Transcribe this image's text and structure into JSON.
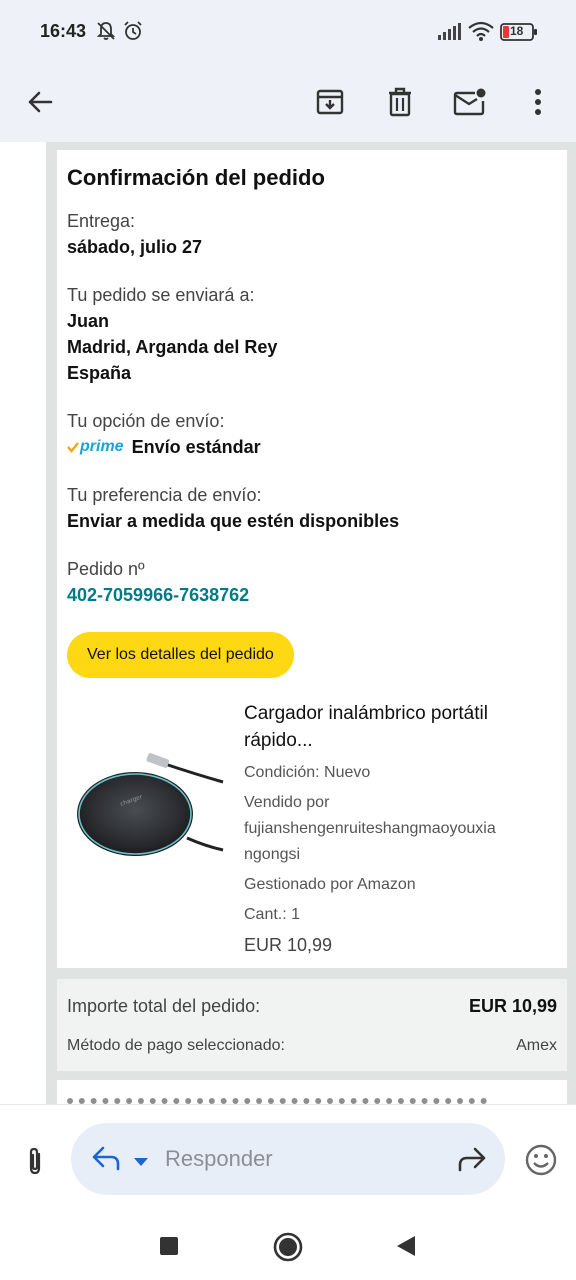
{
  "status_bar": {
    "time": "16:43",
    "icons": [
      "notifications-off-icon",
      "alarm-icon",
      "signal-icon",
      "wifi-icon",
      "battery-icon"
    ],
    "battery_level": "18"
  },
  "toolbar": {
    "icons": [
      "back-arrow-icon",
      "archive-icon",
      "delete-icon",
      "mark-unread-icon",
      "more-vert-icon"
    ]
  },
  "email": {
    "heading": "Confirmación del pedido",
    "delivery_label": "Entrega:",
    "delivery_value": "sábado, julio 27",
    "ship_to_label": "Tu pedido se enviará a:",
    "ship_to_name": "Juan",
    "ship_to_city": "Madrid, Arganda del Rey",
    "ship_to_country": "España",
    "shipping_option_label": "Tu opción de envío:",
    "prime_logo_text": "prime",
    "shipping_option_value": "Envío estándar",
    "shipping_pref_label": "Tu preferencia de envío:",
    "shipping_pref_value": "Enviar a medida que estén disponibles",
    "order_number_label": "Pedido nº",
    "order_number": "402-7059966-7638762",
    "details_button": "Ver los detalles del pedido",
    "product": {
      "title": "Cargador inalámbrico portátil rápido...",
      "condition": "Condición: Nuevo",
      "sold_by_label": "Vendido por",
      "sold_by_value": "fujianshengenruiteshangmaoyouxiangongsi",
      "managed_by": "Gestionado por Amazon",
      "quantity": "Cant.: 1",
      "price": "EUR 10,99"
    },
    "total_label": "Importe total del pedido:",
    "total_value": "EUR 10,99",
    "payment_label": "Método de pago seleccionado:",
    "payment_value": "Amex"
  },
  "reply_bar": {
    "placeholder": "Responder",
    "icons": [
      "attachment-icon",
      "reply-icon",
      "dropdown-icon",
      "forward-icon",
      "emoji-icon"
    ]
  },
  "nav_bar": {
    "icons": [
      "recents-icon",
      "home-icon",
      "back-icon"
    ]
  },
  "colors": {
    "toolbar_bg": "#eef2f8",
    "link": "#017a87",
    "button_yellow": "#ffd814",
    "reply_field_bg": "#e8eef8",
    "reply_blue": "#1a66d2"
  }
}
